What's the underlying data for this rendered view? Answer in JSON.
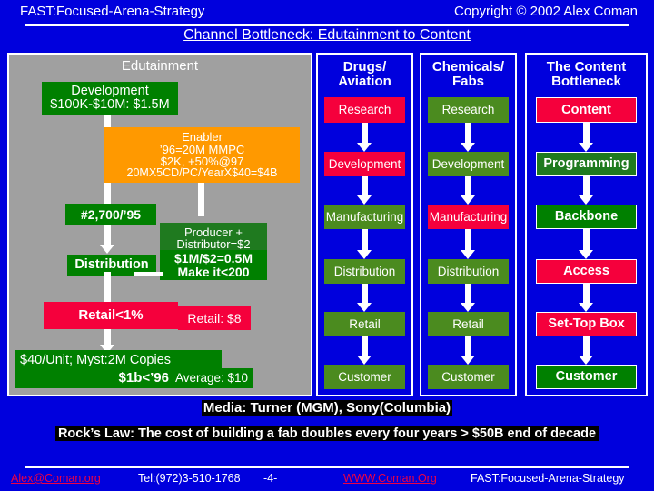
{
  "header": {
    "left": "FAST:Focused-Arena-Strategy",
    "right": "Copyright © 2002 Alex Coman",
    "title": "Channel Bottleneck: Edutainment to Content"
  },
  "edutainment": {
    "heading": "Edutainment",
    "development": "Development\n$100K-$10M: $1.5M",
    "development_line1": "Development",
    "development_line2": "$100K-$10M: $1.5M",
    "enabler_line1": "Enabler",
    "enabler_line2": "’96=20M MMPC",
    "enabler_line3": "$2K, +50%@97",
    "enabler_line4": "20MX5CD/PC/YearX$40=$4B",
    "count": "#2,700/’95",
    "distribution": "Distribution",
    "producer_line1": "Producer +",
    "producer_line2": "Distributor=$2",
    "producer_line3": "$1M/$2=0.5M",
    "producer_line4": "Make it<200",
    "retail": "Retail<1%",
    "retail_price": "Retail: $8",
    "unit_line1": "$40/Unit; Myst:2M Copies",
    "unit_line2": "$1b<’96",
    "average": "Average: $10"
  },
  "columns": [
    {
      "title_line1": "Drugs/",
      "title_line2": "Aviation",
      "steps": [
        {
          "label": "Research",
          "color": "#f5003c"
        },
        {
          "label": "Development",
          "color": "#f5003c"
        },
        {
          "label": "Manufacturing",
          "color": "#4b8b1f"
        },
        {
          "label": "Distribution",
          "color": "#4b8b1f"
        },
        {
          "label": "Retail",
          "color": "#4b8b1f"
        },
        {
          "label": "Customer",
          "color": "#4b8b1f"
        }
      ]
    },
    {
      "title_line1": "Chemicals/",
      "title_line2": "Fabs",
      "steps": [
        {
          "label": "Research",
          "color": "#4b8b1f"
        },
        {
          "label": "Development",
          "color": "#4b8b1f"
        },
        {
          "label": "Manufacturing",
          "color": "#f5003c"
        },
        {
          "label": "Distribution",
          "color": "#4b8b1f"
        },
        {
          "label": "Retail",
          "color": "#4b8b1f"
        },
        {
          "label": "Customer",
          "color": "#4b8b1f"
        }
      ]
    },
    {
      "title_line1": "The Content",
      "title_line2": "Bottleneck",
      "steps": [
        {
          "label": "Content",
          "color": "#f5003c"
        },
        {
          "label": "Programming",
          "color": "#1f7a1f"
        },
        {
          "label": "Backbone",
          "color": "#008000"
        },
        {
          "label": "Access",
          "color": "#f5003c"
        },
        {
          "label": "Set-Top Box",
          "color": "#f5003c"
        },
        {
          "label": "Customer",
          "color": "#008000"
        }
      ]
    }
  ],
  "bottom": {
    "media": "Media: Turner (MGM), Sony(Columbia)",
    "rocks_law": "Rock’s Law: The cost of building a fab doubles every four years > $50B end of decade"
  },
  "footer": {
    "email": "Alex@Coman.org",
    "tel": "Tel:(972)3-510-1768",
    "page": "-4-",
    "www": "WWW.Coman.Org",
    "brand": "FAST:Focused-Arena-Strategy"
  },
  "colors": {
    "background": "#0000dd",
    "panel_gray": "#a0a0a0",
    "green": "#008000",
    "olive": "#4b8b1f",
    "red": "#f5003c",
    "orange": "#ff9900",
    "white": "#ffffff"
  }
}
